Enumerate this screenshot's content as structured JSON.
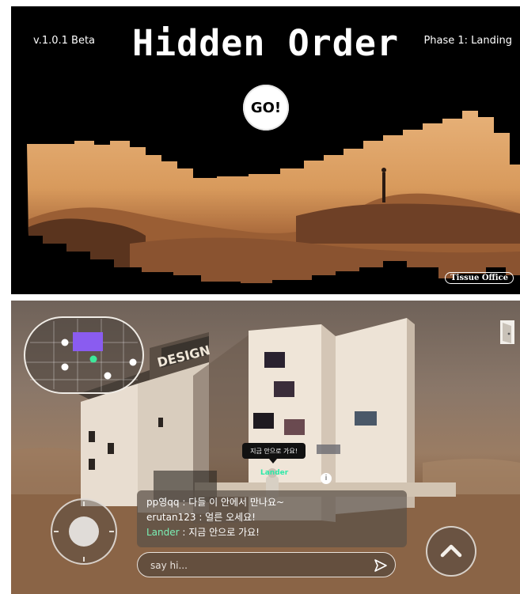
{
  "title_screen": {
    "version": "v.1.0.1 Beta",
    "title": "Hidden Order",
    "phase": "Phase 1: Landing",
    "go_label": "GO!",
    "credit": "Tissue Office"
  },
  "game_scene": {
    "building_sign": "DESIGN",
    "speech_bubble": "지금 안으로 가요!",
    "avatar_name": "Lander",
    "info_icon_glyph": "i",
    "chat": [
      {
        "user": "pp영qq",
        "sep": " : ",
        "message": "다들 이 안에서 만나요~"
      },
      {
        "user": "erutan123",
        "sep": " : ",
        "message": "얼른 오세요!"
      },
      {
        "user": "Lander",
        "sep": " : ",
        "message": "지금 안으로 가요!"
      }
    ],
    "chat_input_placeholder": "say hi...",
    "icons": [
      "minimap-icon",
      "exit-door-icon",
      "send-icon",
      "joystick-icon",
      "chevron-up-icon",
      "info-icon"
    ],
    "colors": {
      "self_name": "#7af0b5",
      "avatar_label": "#2ee8a8",
      "minimap_room": "#8a5cf0",
      "minimap_self": "#3ee89a"
    }
  }
}
